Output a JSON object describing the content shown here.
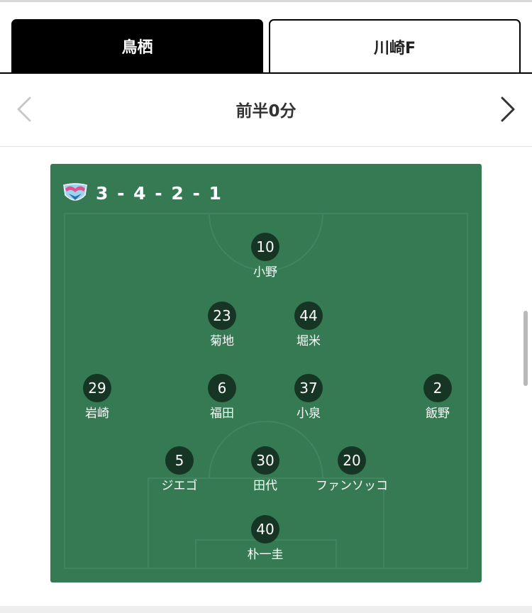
{
  "tabs": [
    {
      "label": "鳥栖",
      "active": true
    },
    {
      "label": "川崎F",
      "active": false
    }
  ],
  "period": {
    "title": "前半0分",
    "prev_icon": "chevron-left-icon",
    "next_icon": "chevron-right-icon"
  },
  "lineup": {
    "team_crest_icon": "sagan-tosu-crest-icon",
    "formation": "3 - 4 - 2 - 1",
    "players": [
      {
        "number": "10",
        "name": "小野"
      },
      {
        "number": "23",
        "name": "菊地"
      },
      {
        "number": "44",
        "name": "堀米"
      },
      {
        "number": "29",
        "name": "岩崎"
      },
      {
        "number": "6",
        "name": "福田"
      },
      {
        "number": "37",
        "name": "小泉"
      },
      {
        "number": "2",
        "name": "飯野"
      },
      {
        "number": "5",
        "name": "ジエゴ"
      },
      {
        "number": "30",
        "name": "田代"
      },
      {
        "number": "20",
        "name": "ファンソッコ"
      },
      {
        "number": "40",
        "name": "朴一圭"
      }
    ]
  },
  "colors": {
    "pitch": "#357a53",
    "number_badge": "#163524",
    "active_tab": "#000000"
  }
}
